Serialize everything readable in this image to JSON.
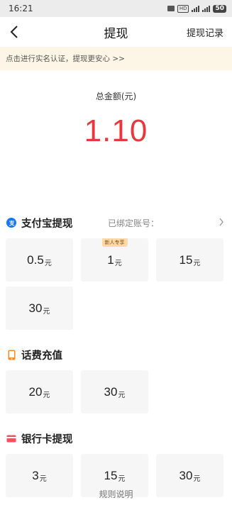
{
  "status": {
    "time": "16:21",
    "battery": "50"
  },
  "nav": {
    "title": "提现",
    "records": "提现记录"
  },
  "notice": "点击进行实名认证，提现更安心 >>",
  "summary": {
    "label": "总金额(元)",
    "amount": "1.10"
  },
  "alipay": {
    "title": "支付宝提现",
    "bound_label": "已绑定账号：",
    "tiles": [
      {
        "value": "0.5",
        "unit": "元",
        "badge": ""
      },
      {
        "value": "1",
        "unit": "元",
        "badge": "新人专享"
      },
      {
        "value": "15",
        "unit": "元",
        "badge": ""
      },
      {
        "value": "30",
        "unit": "元",
        "badge": ""
      }
    ]
  },
  "phone": {
    "title": "话费充值",
    "tiles": [
      {
        "value": "20",
        "unit": "元"
      },
      {
        "value": "30",
        "unit": "元"
      }
    ]
  },
  "bank": {
    "title": "银行卡提现",
    "tiles": [
      {
        "value": "3",
        "unit": "元"
      },
      {
        "value": "15",
        "unit": "元"
      },
      {
        "value": "30",
        "unit": "元"
      }
    ]
  },
  "footer": "规则说明",
  "colors": {
    "accent": "#e8383d",
    "alipay": "#1677ff",
    "phone": "#ff8a1f",
    "bank": "#f2545b"
  }
}
